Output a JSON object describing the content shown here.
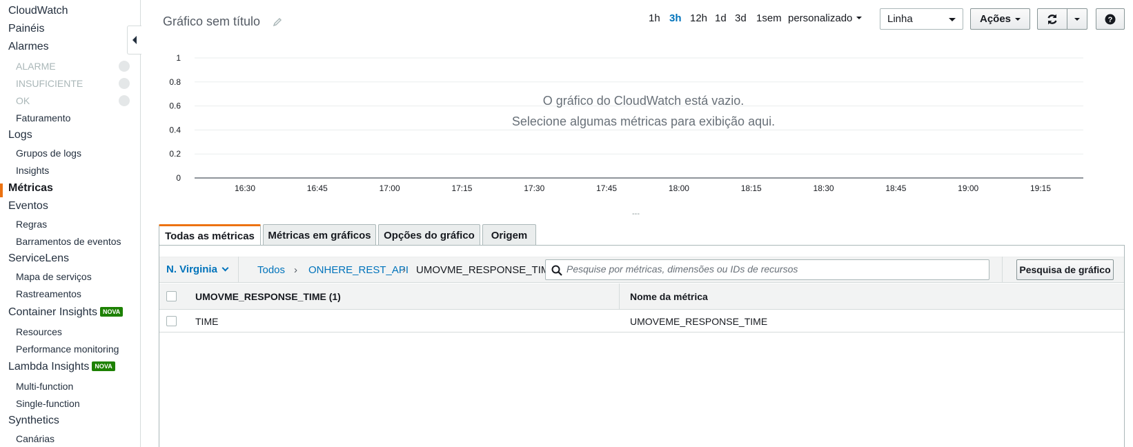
{
  "sidebar": {
    "items": [
      {
        "label": "CloudWatch"
      },
      {
        "label": "Painéis"
      },
      {
        "label": "Alarmes"
      },
      {
        "label": "ALARME"
      },
      {
        "label": "INSUFICIENTE"
      },
      {
        "label": "OK"
      },
      {
        "label": "Faturamento"
      },
      {
        "label": "Logs"
      },
      {
        "label": "Grupos de logs"
      },
      {
        "label": "Insights"
      },
      {
        "label": "Métricas"
      },
      {
        "label": "Eventos"
      },
      {
        "label": "Regras"
      },
      {
        "label": "Barramentos de eventos"
      },
      {
        "label": "ServiceLens"
      },
      {
        "label": "Mapa de serviços"
      },
      {
        "label": "Rastreamentos"
      },
      {
        "label": "Container Insights"
      },
      {
        "label": "Resources"
      },
      {
        "label": "Performance monitoring"
      },
      {
        "label": "Lambda Insights"
      },
      {
        "label": "Multi-function"
      },
      {
        "label": "Single-function"
      },
      {
        "label": "Synthetics"
      },
      {
        "label": "Canárias"
      }
    ],
    "badge": "NOVA"
  },
  "header": {
    "title": "Gráfico sem título",
    "ranges": [
      "1h",
      "3h",
      "12h",
      "1d",
      "3d",
      "1sem",
      "personalizado"
    ],
    "selected_range": "3h",
    "type_select": "Linha",
    "actions_label": "Ações",
    "help_label": "?"
  },
  "chart_data": {
    "type": "line",
    "y_ticks": [
      "1",
      "0.8",
      "0.6",
      "0.4",
      "0.2",
      "0"
    ],
    "x_ticks": [
      "16:30",
      "16:45",
      "17:00",
      "17:15",
      "17:30",
      "17:45",
      "18:00",
      "18:15",
      "18:30",
      "18:45",
      "19:00",
      "19:15"
    ],
    "ylim": [
      0,
      1
    ],
    "grid": true,
    "series": [],
    "empty_line1": "O gráfico do CloudWatch está vazio.",
    "empty_line2": "Selecione algumas métricas para exibição aqui.",
    "legend_marker": "---"
  },
  "tabs": [
    "Todas as métricas",
    "Métricas em gráficos",
    "Opções do gráfico",
    "Origem"
  ],
  "toolbar": {
    "region": "N. Virginia",
    "breadcrumb": [
      "Todos",
      "ONHERE_REST_API",
      "UMOVME_RESPONSE_TIME"
    ],
    "search_placeholder": "Pesquise por métricas, dimensões ou IDs de recursos",
    "search_button": "Pesquisa de gráfico"
  },
  "table": {
    "headers": [
      "UMOVME_RESPONSE_TIME (1)",
      "Nome da métrica"
    ],
    "rows": [
      [
        "TIME",
        "UMOVEME_RESPONSE_TIME"
      ]
    ]
  }
}
